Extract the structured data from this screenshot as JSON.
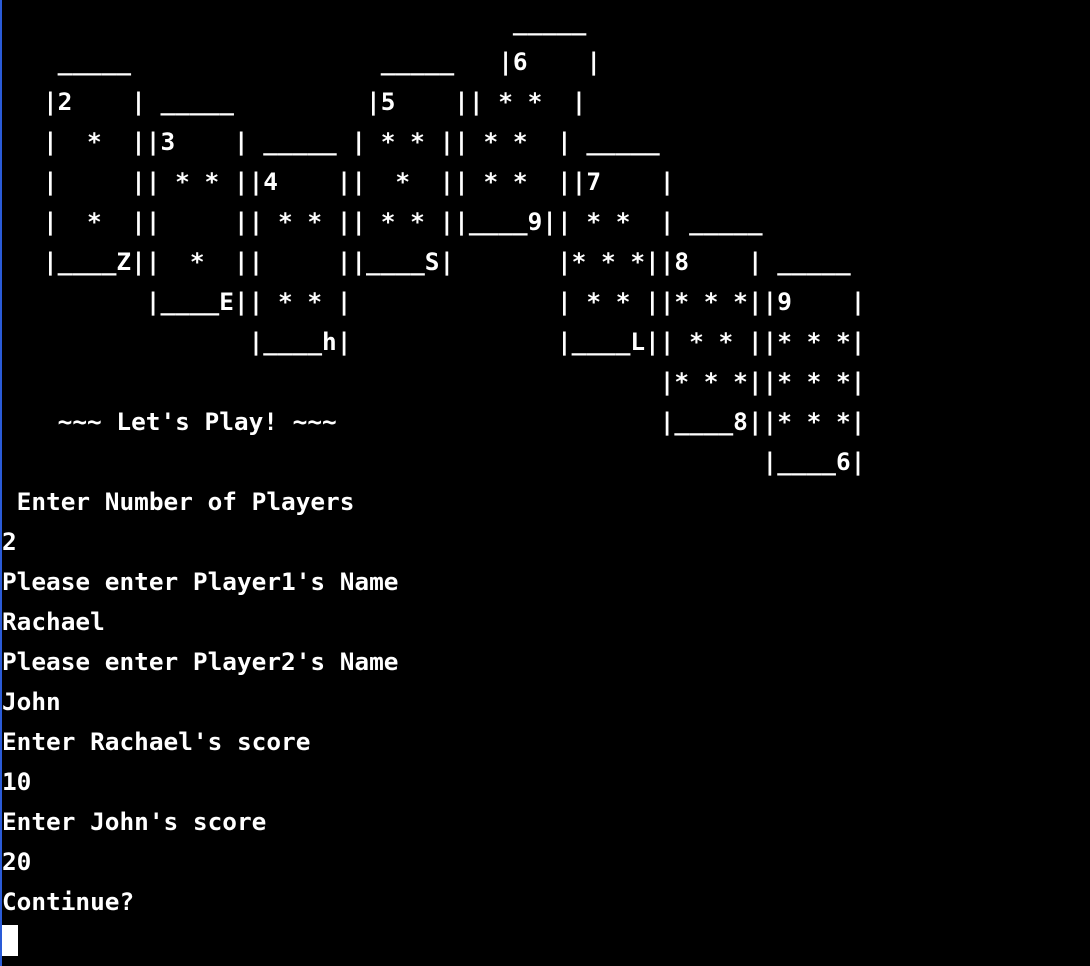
{
  "terminal": {
    "banner_lines": [
      "                                _____",
      " _____                 _____   |6    |",
      "|2    | _____         |5    || * *  |",
      "|  *  ||3    | _____ | * * || * *  | _____",
      "|     || * * ||4    ||  *  || * *  ||7    |",
      "|  *  ||     || * * || * * ||____9|| * *  | _____",
      "|____Z||  *  ||     ||____S|       |* * *||8    | _____",
      "       |____E|| * * |              | * * ||* * *||9    |",
      "              |____h|              |____L|| * * ||* * *|",
      "                                          |* * *||* * *|",
      " ~~~ Let's Play! ~~~                      |____8||* * *|",
      "                                                 |____6|"
    ],
    "session_lines": [
      " Enter Number of Players",
      "2",
      "Please enter Player1's Name",
      "Rachael",
      "Please enter Player2's Name",
      "John",
      "Enter Rachael's score",
      "10",
      "Enter John's score",
      "20",
      "Continue?"
    ],
    "colors": {
      "background": "#000000",
      "foreground": "#ffffff",
      "window_edge": "#2a5bd7"
    }
  }
}
